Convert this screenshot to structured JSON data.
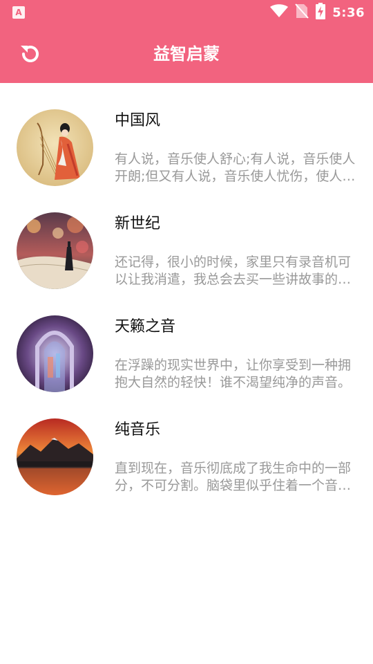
{
  "status_bar": {
    "time": "5:36",
    "icons": [
      "app-notification-icon",
      "wifi-icon",
      "no-sim-icon",
      "battery-charging-icon"
    ]
  },
  "app_bar": {
    "title": "益智启蒙",
    "back_icon": "back-undo-icon"
  },
  "colors": {
    "primary": "#f2637f",
    "title_text": "#111111",
    "desc_text": "#999999"
  },
  "items": [
    {
      "title": "中国风",
      "description": "有人说，音乐使人舒心;有人说，音乐使人开朗;但又有人说，音乐使人忧伤，使人烦恼。"
    },
    {
      "title": "新世纪",
      "description": "还记得，很小的时候，家里只有录音机可以让我消遣，我总会去买一些讲故事的磁带。"
    },
    {
      "title": "天籁之音",
      "description": "在浮躁的现实世界中，让你享受到一种拥抱大自然的轻快！谁不渴望纯净的声音。"
    },
    {
      "title": "纯音乐",
      "description": "直到现在，音乐彻底成了我生命中的一部分，不可分割。脑袋里似乎住着一个音符。"
    }
  ]
}
